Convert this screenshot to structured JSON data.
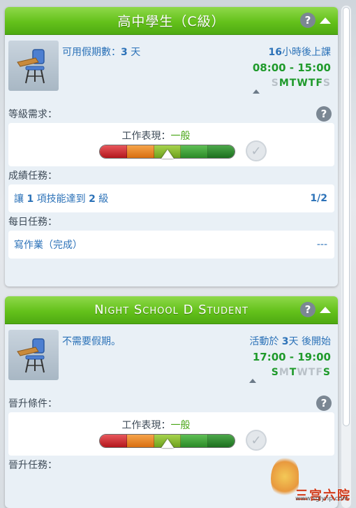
{
  "colors": {
    "header_green": "#64c11b",
    "text_blue": "#2c72b8",
    "hours_green": "#1f9a2b",
    "performance_green": "#49a617"
  },
  "career1": {
    "title": "高中學生（C級）",
    "help_icon": "?",
    "leave_label": "可用假期數：",
    "leave_value": "3",
    "leave_unit": " 天",
    "next_num": "16",
    "next_text": "小時後上課",
    "hours": "08:00 -  15:00",
    "days": [
      "S",
      "M",
      "T",
      "W",
      "T",
      "F",
      "S"
    ],
    "days_active": [
      false,
      true,
      true,
      true,
      true,
      true,
      false
    ],
    "requirements_label": "等級需求：",
    "performance_label": "工作表現：",
    "performance_value": "一般",
    "performance_level": 0.5,
    "grades_label": "成績任務：",
    "task1_a": "讓 ",
    "task1_num1": "1",
    "task1_b": " 項技能達到 ",
    "task1_num2": "2",
    "task1_c": " 級",
    "task1_progress": "1/2",
    "daily_label": "每日任務：",
    "daily_task": "寫作業（完成）",
    "daily_progress": "---"
  },
  "career2": {
    "title": "Night School D Student",
    "help_icon": "?",
    "leave_text": "不需要假期。",
    "next_a": "活動於 ",
    "next_num": "3",
    "next_b": "天 後開始",
    "hours": "17:00 -  19:00",
    "days": [
      "S",
      "M",
      "T",
      "W",
      "T",
      "F",
      "S"
    ],
    "days_active": [
      true,
      false,
      true,
      false,
      false,
      false,
      true
    ],
    "requirements_label": "晉升條件：",
    "performance_label": "工作表現：",
    "performance_value": "一般",
    "performance_level": 0.5,
    "tasks_label": "晉升任務："
  },
  "watermark": {
    "text": "三宫六院",
    "url": "www.sglynp.com"
  }
}
